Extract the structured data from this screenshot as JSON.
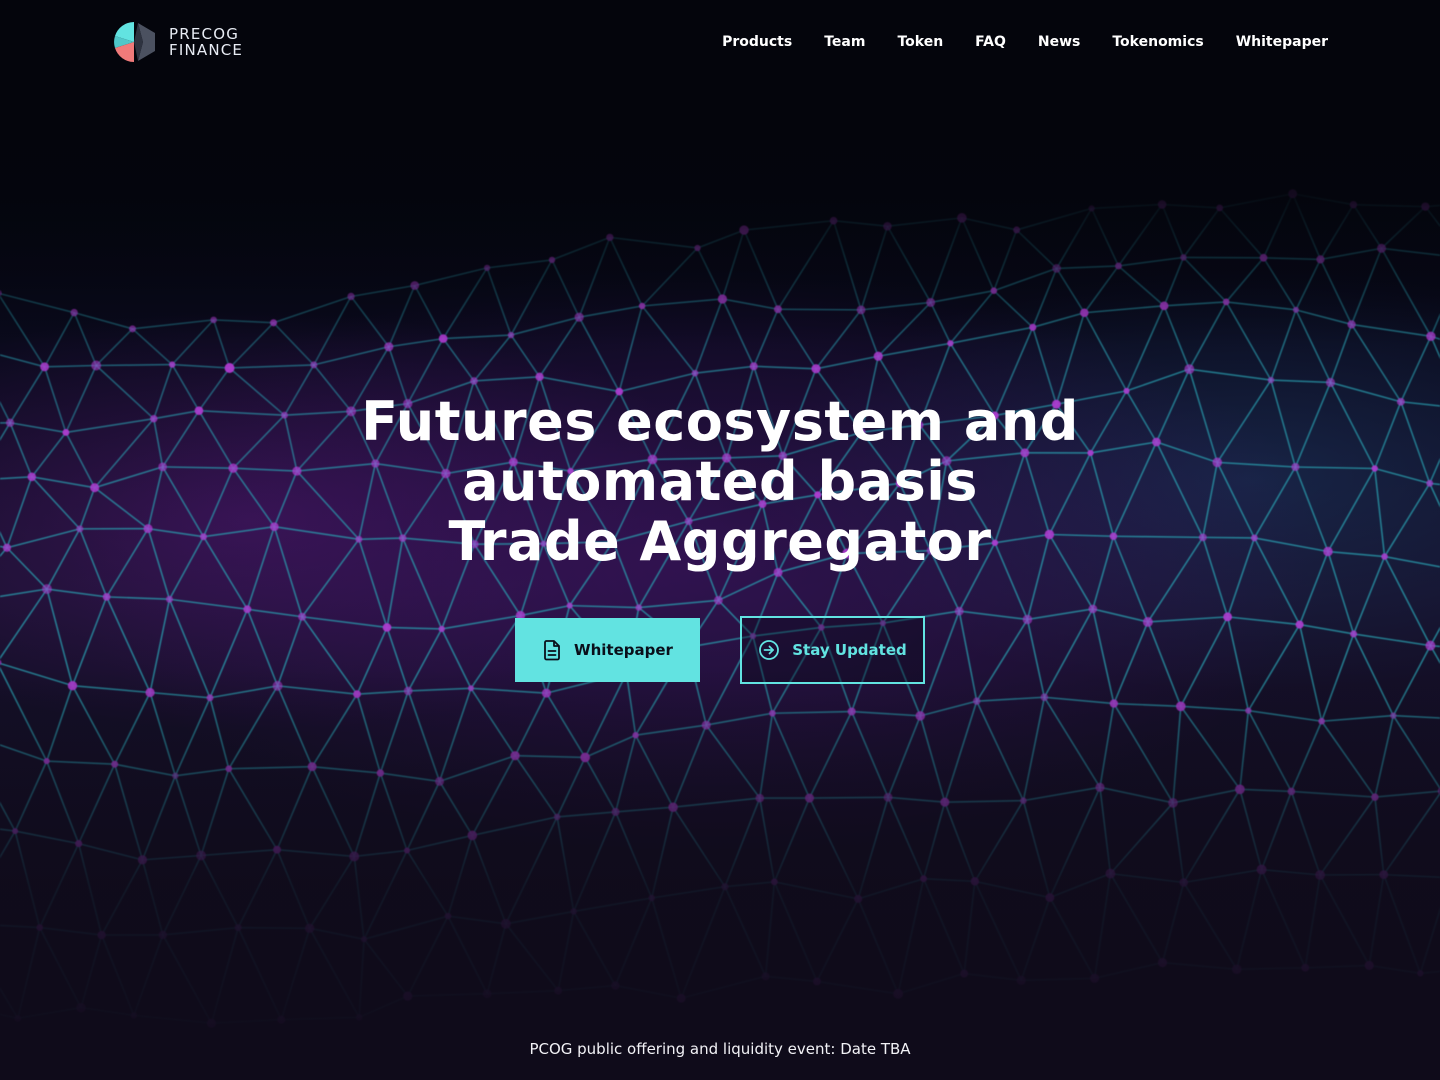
{
  "brand": {
    "line1": "PRECOG",
    "line2": "FINANCE",
    "colors": {
      "cyan": "#62e3e1",
      "coral": "#f07a7a",
      "slate": "#4b5160"
    }
  },
  "nav": {
    "items": [
      {
        "label": "Products"
      },
      {
        "label": "Team"
      },
      {
        "label": "Token"
      },
      {
        "label": "FAQ"
      },
      {
        "label": "News"
      },
      {
        "label": "Tokenomics"
      },
      {
        "label": "Whitepaper"
      }
    ]
  },
  "hero": {
    "title_lines": [
      "Futures ecosystem and",
      "automated basis",
      "Trade Aggregator"
    ]
  },
  "cta": {
    "primary": {
      "label": "Whitepaper",
      "icon": "document-icon"
    },
    "secondary": {
      "label": "Stay Updated",
      "icon": "arrow-circle-right-icon"
    }
  },
  "announcement": {
    "text": "PCOG public offering and liquidity event: Date TBA"
  },
  "theme": {
    "accent": "#62e3e1",
    "background": "#05060f",
    "mesh_line": "#2a9fb0",
    "mesh_node": "#b03ad0"
  }
}
